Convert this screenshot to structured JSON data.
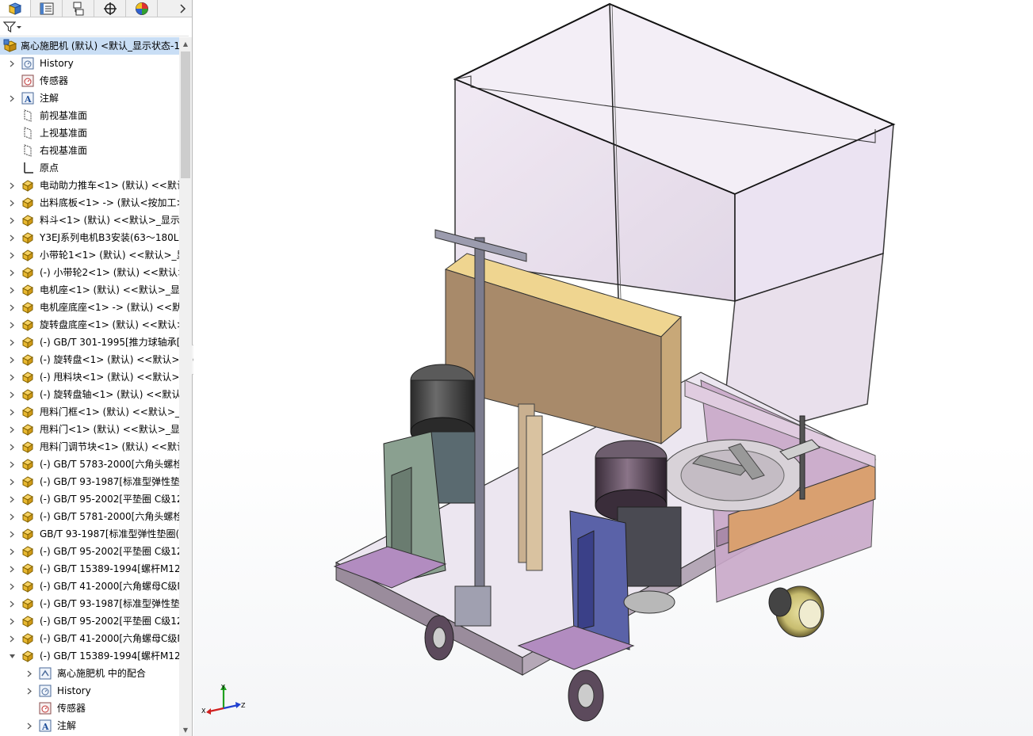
{
  "tabs": [
    {
      "name": "featuremanager-tab",
      "icon": "featuremanager-icon"
    },
    {
      "name": "propertymanager-tab",
      "icon": "propertymanager-icon"
    },
    {
      "name": "configurationmanager-tab",
      "icon": "configurationmanager-icon"
    },
    {
      "name": "dimxpert-tab",
      "icon": "dimxpert-icon"
    },
    {
      "name": "display-manager-tab",
      "icon": "display-manager-icon"
    }
  ],
  "tree": [
    {
      "label": "离心施肥机 (默认) <默认_显示状态-1",
      "icon": "assembly",
      "level": 0,
      "exp": "none",
      "root": true
    },
    {
      "label": "History",
      "icon": "history",
      "level": 1,
      "exp": "right"
    },
    {
      "label": "传感器",
      "icon": "sensor",
      "level": 1,
      "exp": "none"
    },
    {
      "label": "注解",
      "icon": "annotation",
      "level": 1,
      "exp": "right"
    },
    {
      "label": "前视基准面",
      "icon": "plane",
      "level": 1,
      "exp": "none"
    },
    {
      "label": "上视基准面",
      "icon": "plane",
      "level": 1,
      "exp": "none"
    },
    {
      "label": "右视基准面",
      "icon": "plane",
      "level": 1,
      "exp": "none"
    },
    {
      "label": "原点",
      "icon": "origin",
      "level": 1,
      "exp": "none"
    },
    {
      "label": "电动助力推车<1> (默认) <<默认",
      "icon": "part",
      "level": 1,
      "exp": "right"
    },
    {
      "label": "出料底板<1> -> (默认<按加工>",
      "icon": "part",
      "level": 1,
      "exp": "right"
    },
    {
      "label": "料斗<1> (默认) <<默认>_显示状",
      "icon": "part",
      "level": 1,
      "exp": "right"
    },
    {
      "label": "Y3EJ系列电机B3安装(63～180L)",
      "icon": "part",
      "level": 1,
      "exp": "right"
    },
    {
      "label": "小带轮1<1> (默认) <<默认>_显",
      "icon": "part",
      "level": 1,
      "exp": "right"
    },
    {
      "label": "(-) 小带轮2<1> (默认) <<默认>",
      "icon": "part",
      "level": 1,
      "exp": "right"
    },
    {
      "label": "电机座<1> (默认) <<默认>_显示",
      "icon": "part",
      "level": 1,
      "exp": "right"
    },
    {
      "label": "电机座底座<1> -> (默认) <<默",
      "icon": "part",
      "level": 1,
      "exp": "right"
    },
    {
      "label": "旋转盘底座<1> (默认) <<默认>",
      "icon": "part",
      "level": 1,
      "exp": "right"
    },
    {
      "label": "(-) GB/T 301-1995[推力球轴承[",
      "icon": "part",
      "level": 1,
      "exp": "right"
    },
    {
      "label": "(-) 旋转盘<1> (默认) <<默认>_",
      "icon": "part",
      "level": 1,
      "exp": "right"
    },
    {
      "label": "(-) 甩料块<1> (默认) <<默认>_",
      "icon": "part",
      "level": 1,
      "exp": "right"
    },
    {
      "label": "(-) 旋转盘轴<1> (默认) <<默认",
      "icon": "part",
      "level": 1,
      "exp": "right"
    },
    {
      "label": "甩料门框<1> (默认) <<默认>_显",
      "icon": "part",
      "level": 1,
      "exp": "right"
    },
    {
      "label": "甩料门<1> (默认) <<默认>_显示",
      "icon": "part",
      "level": 1,
      "exp": "right"
    },
    {
      "label": "甩料门调节块<1> (默认) <<默认",
      "icon": "part",
      "level": 1,
      "exp": "right"
    },
    {
      "label": "(-) GB/T 5783-2000[六角头螺栓",
      "icon": "part",
      "level": 1,
      "exp": "right"
    },
    {
      "label": "(-) GB/T 93-1987[标准型弹性垫",
      "icon": "part",
      "level": 1,
      "exp": "right"
    },
    {
      "label": "(-) GB/T 95-2002[平垫圈 C级12",
      "icon": "part",
      "level": 1,
      "exp": "right"
    },
    {
      "label": "(-) GB/T 5781-2000[六角头螺栓",
      "icon": "part",
      "level": 1,
      "exp": "right"
    },
    {
      "label": "GB/T 93-1987[标准型弹性垫圈(",
      "icon": "part",
      "level": 1,
      "exp": "right"
    },
    {
      "label": "(-) GB/T 95-2002[平垫圈 C级12",
      "icon": "part",
      "level": 1,
      "exp": "right"
    },
    {
      "label": "(-) GB/T 15389-1994[螺杆M12",
      "icon": "part",
      "level": 1,
      "exp": "right"
    },
    {
      "label": "(-) GB/T 41-2000[六角螺母C级M",
      "icon": "part",
      "level": 1,
      "exp": "right"
    },
    {
      "label": "(-) GB/T 93-1987[标准型弹性垫",
      "icon": "part",
      "level": 1,
      "exp": "right"
    },
    {
      "label": "(-) GB/T 95-2002[平垫圈 C级12",
      "icon": "part",
      "level": 1,
      "exp": "right"
    },
    {
      "label": "(-) GB/T 41-2000[六角螺母C级M",
      "icon": "part",
      "level": 1,
      "exp": "right"
    },
    {
      "label": "(-) GB/T 15389-1994[螺杆M12",
      "icon": "part",
      "level": 1,
      "exp": "down"
    },
    {
      "label": "离心施肥机 中的配合",
      "icon": "mates",
      "level": 2,
      "exp": "right"
    },
    {
      "label": "History",
      "icon": "history",
      "level": 2,
      "exp": "right"
    },
    {
      "label": "传感器",
      "icon": "sensor",
      "level": 2,
      "exp": "none"
    },
    {
      "label": "注解",
      "icon": "annotation",
      "level": 2,
      "exp": "right"
    }
  ],
  "triad": {
    "x": "X",
    "y": "Y",
    "z": "Z"
  },
  "colors": {
    "selection": "#c9def5",
    "part_icon": "#f0c030",
    "axis_x": "#d02020",
    "axis_y": "#20a020",
    "axis_z": "#2040d0"
  }
}
